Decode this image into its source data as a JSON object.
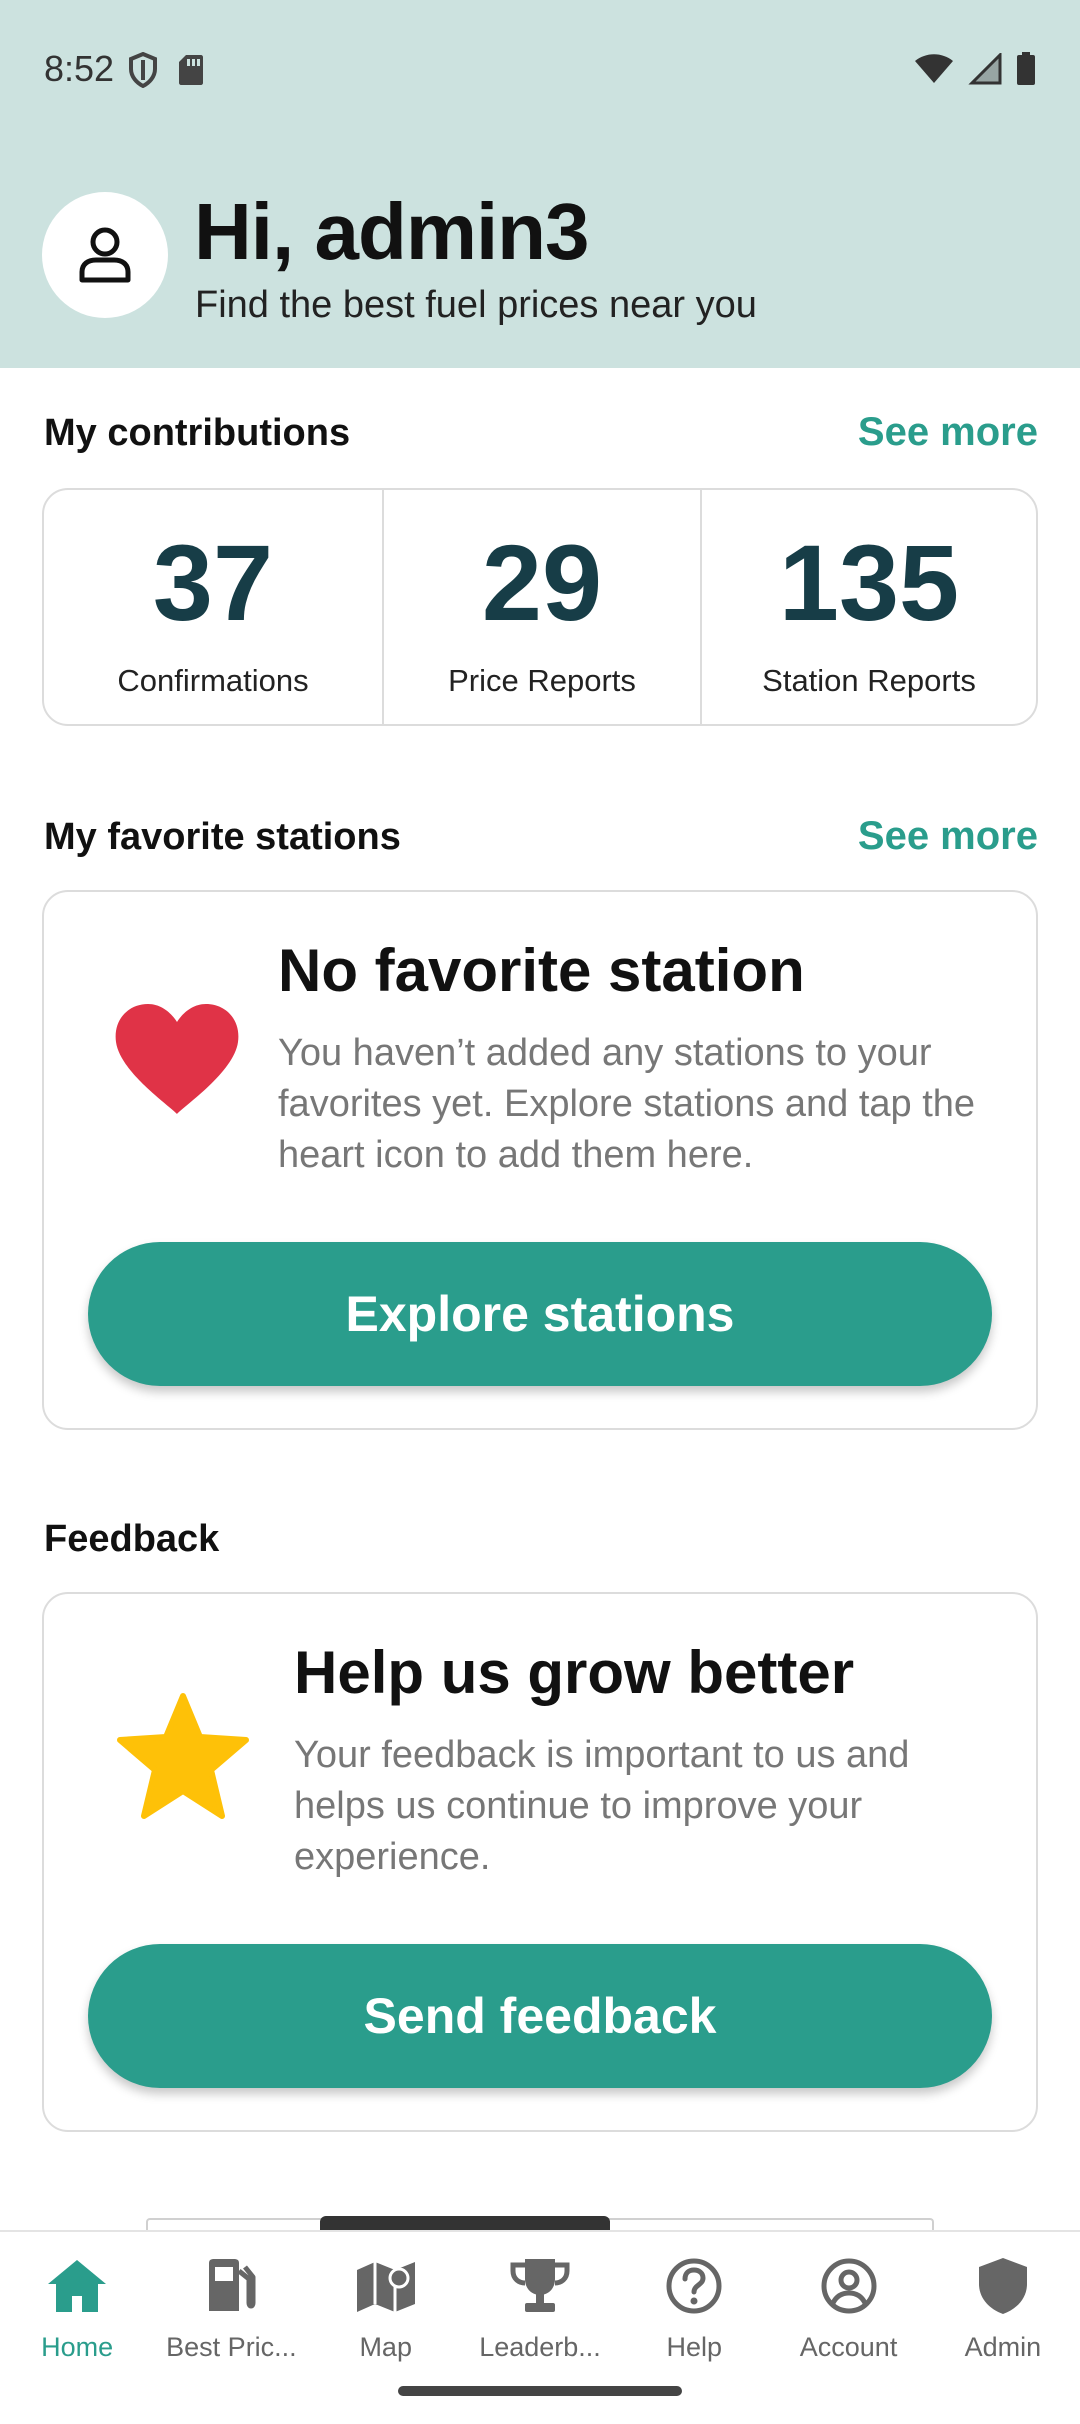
{
  "status_bar": {
    "time": "8:52",
    "left_icons": [
      "shield-icon",
      "sd-card-icon"
    ],
    "right_icons": [
      "wifi-icon",
      "signal-icon",
      "battery-icon"
    ]
  },
  "header": {
    "greeting": "Hi, admin3",
    "subtitle": "Find the best fuel prices near you",
    "avatar_icon": "user-icon"
  },
  "contributions": {
    "title": "My contributions",
    "see_more": "See more",
    "stats": [
      {
        "value": "37",
        "label": "Confirmations"
      },
      {
        "value": "29",
        "label": "Price Reports"
      },
      {
        "value": "135",
        "label": "Station Reports"
      }
    ]
  },
  "favorites": {
    "title": "My favorite stations",
    "see_more": "See more",
    "card_title": "No favorite station",
    "card_text": "You haven’t added any stations to your favorites yet. Explore stations and tap the heart icon to add them here.",
    "button": "Explore stations",
    "icon": "heart-icon"
  },
  "feedback": {
    "title": "Feedback",
    "card_title": "Help us grow better",
    "card_text": "Your feedback is important to us and helps us continue to improve your experience.",
    "button": "Send feedback",
    "icon": "star-icon"
  },
  "bottom_nav": {
    "items": [
      {
        "label": "Home",
        "icon": "home-icon",
        "active": true
      },
      {
        "label": "Best Pric...",
        "icon": "fuel-pump-icon",
        "active": false
      },
      {
        "label": "Map",
        "icon": "map-icon",
        "active": false
      },
      {
        "label": "Leaderb...",
        "icon": "trophy-icon",
        "active": false
      },
      {
        "label": "Help",
        "icon": "help-icon",
        "active": false
      },
      {
        "label": "Account",
        "icon": "account-icon",
        "active": false
      },
      {
        "label": "Admin",
        "icon": "admin-shield-icon",
        "active": false
      }
    ]
  },
  "colors": {
    "header_bg": "#cce2df",
    "accent": "#2a9d8c",
    "stat_number": "#173d47",
    "heart": "#e03347",
    "star": "#fec108"
  }
}
